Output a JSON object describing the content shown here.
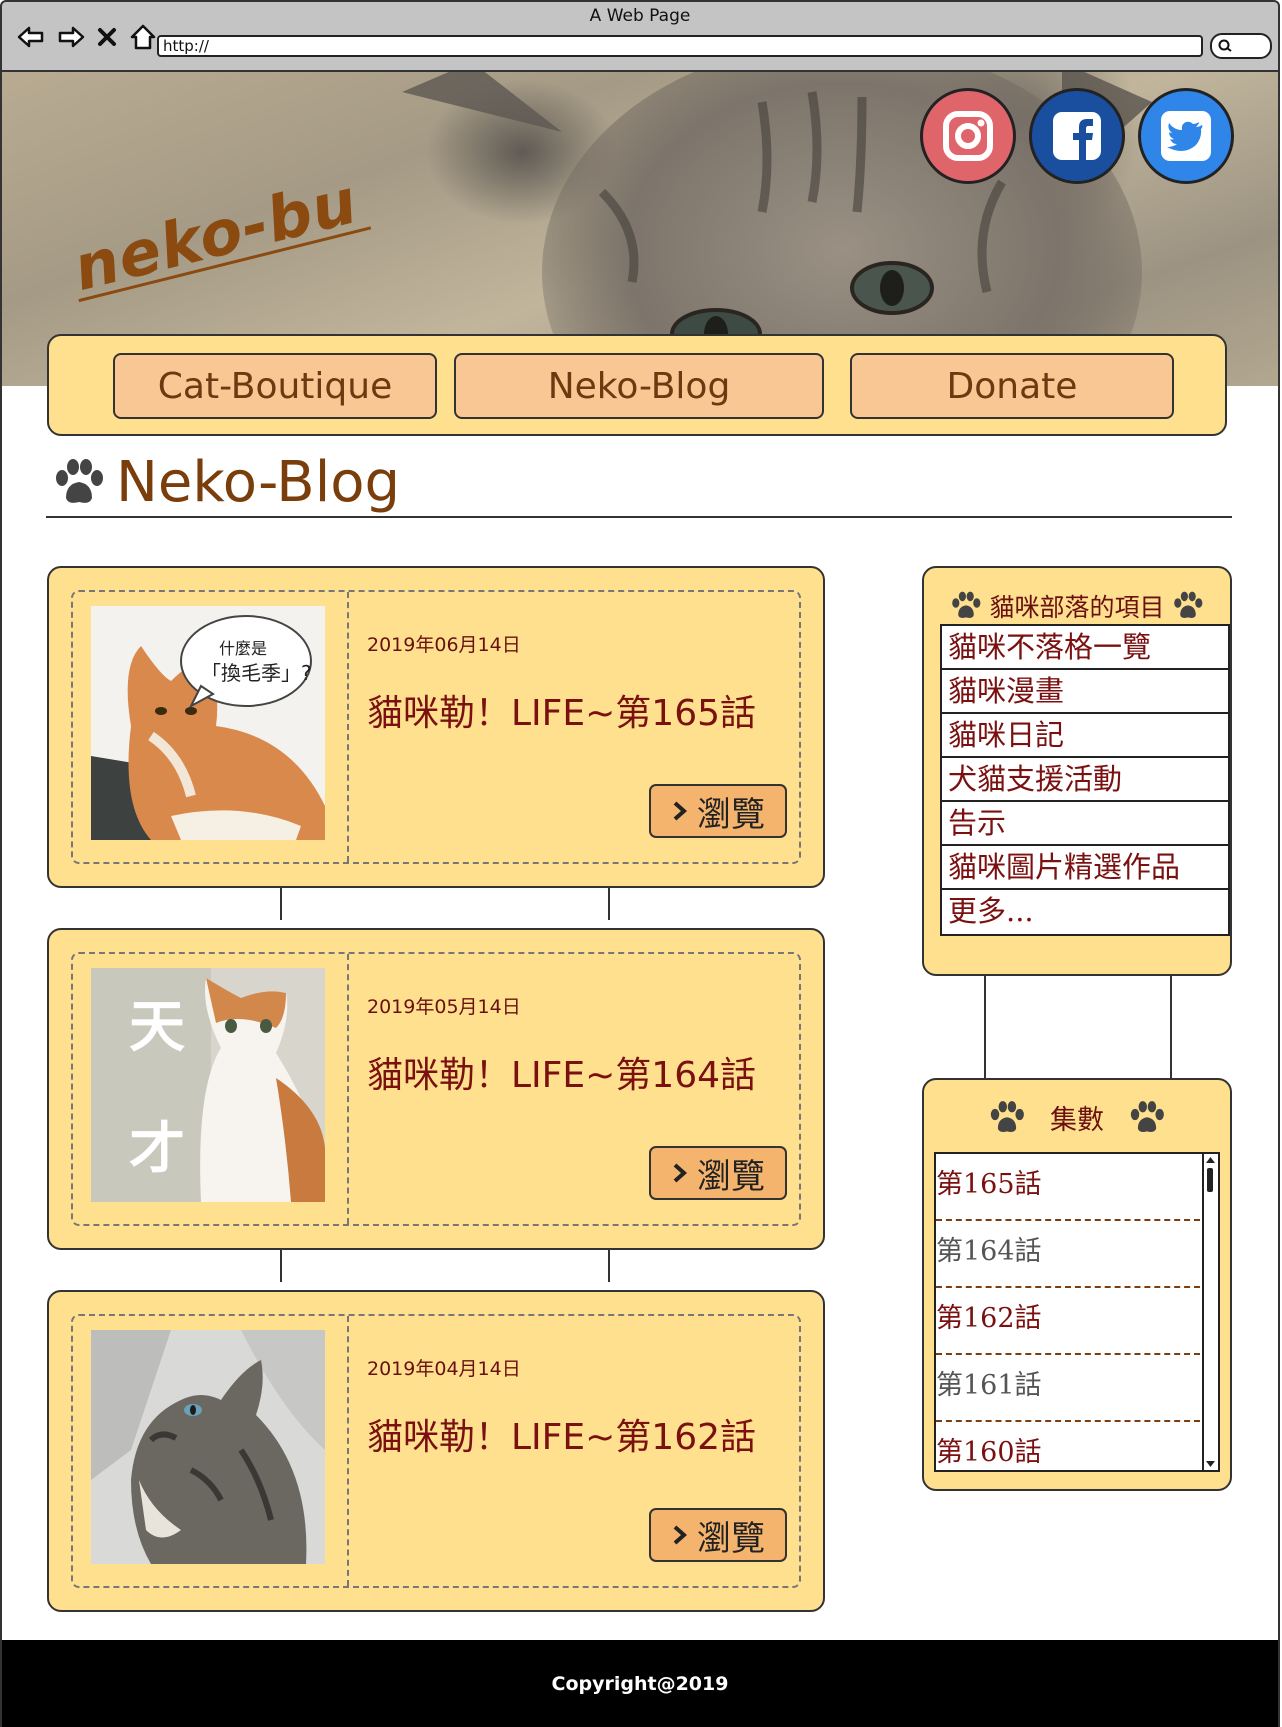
{
  "browser": {
    "title": "A Web Page",
    "url": "http://"
  },
  "site": {
    "logo": "neko-bu",
    "social": [
      "instagram-icon",
      "facebook-icon",
      "twitter-icon"
    ]
  },
  "nav": {
    "items": [
      "Cat-Boutique",
      "Neko-Blog",
      "Donate"
    ]
  },
  "page": {
    "heading": "Neko-Blog"
  },
  "posts": [
    {
      "date": "2019年06月14日",
      "title": "貓咪勒！LIFE~第165話",
      "button": "瀏覽",
      "thumb_text": "什麼是「換毛季」?"
    },
    {
      "date": "2019年05月14日",
      "title": "貓咪勒！LIFE~第164話",
      "button": "瀏覽",
      "thumb_text": "天才"
    },
    {
      "date": "2019年04月14日",
      "title": "貓咪勒！LIFE~第162話",
      "button": "瀏覽"
    }
  ],
  "sidebar": {
    "categories_title": "貓咪部落的項目",
    "categories": [
      "貓咪不落格一覽",
      "貓咪漫畫",
      "貓咪日記",
      "犬貓支援活動",
      "告示",
      "貓咪圖片精選作品",
      "更多..."
    ],
    "episodes_title": "集數",
    "episodes": [
      "第165話",
      "第164話",
      "第162話",
      "第161話",
      "第160話"
    ]
  },
  "footer": {
    "copyright": "Copyright@2019"
  },
  "colors": {
    "panel": "#ffe08f",
    "button": "#f8c793",
    "view_button": "#f5b46e",
    "brown": "#7a3e0c",
    "dark_red": "#7a1010"
  }
}
